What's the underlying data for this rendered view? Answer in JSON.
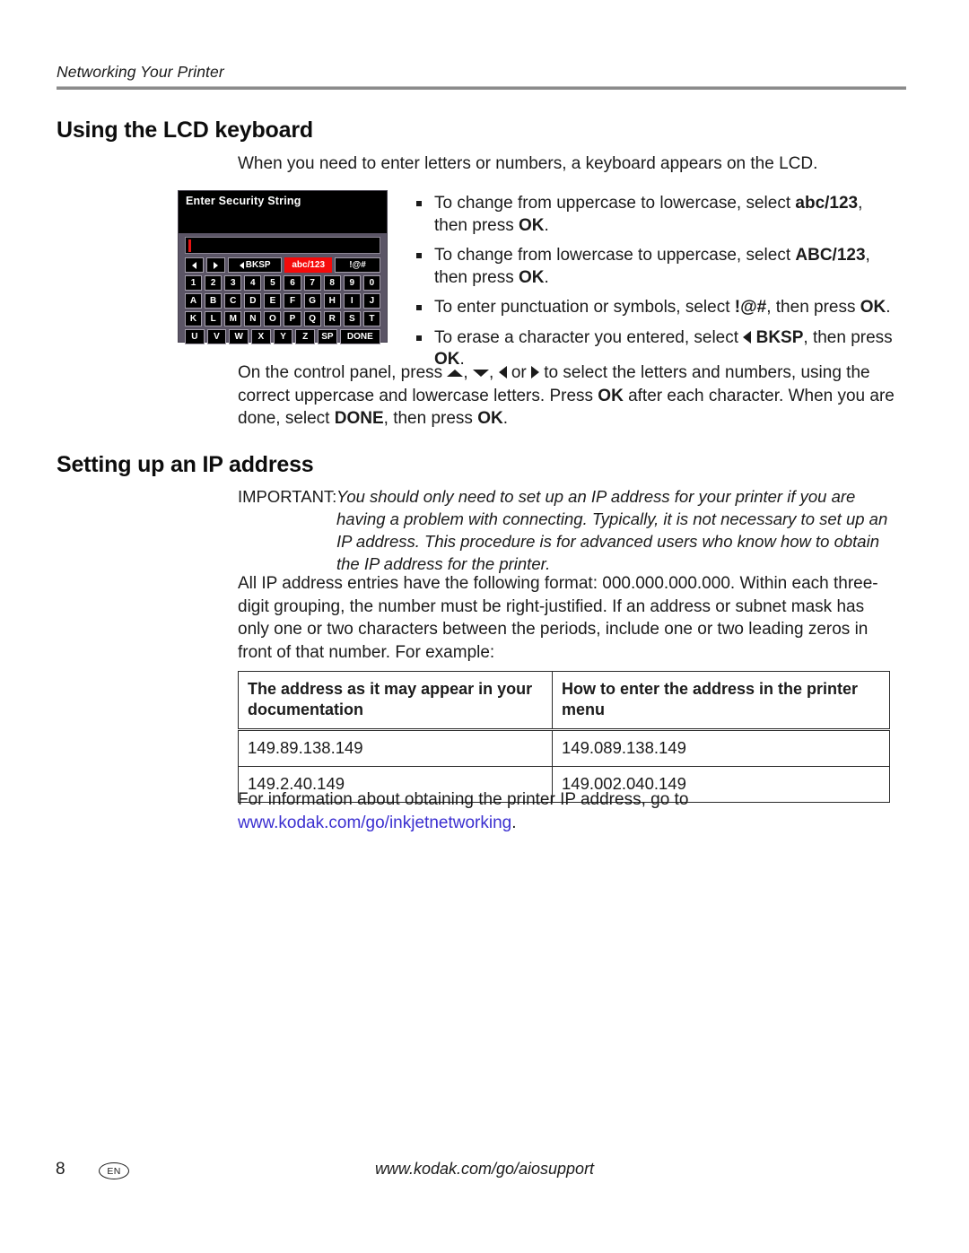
{
  "header": {
    "running_head": "Networking Your Printer"
  },
  "sections": [
    {
      "id": "lcd_keyboard",
      "title": "Using the LCD keyboard"
    },
    {
      "id": "ip_address",
      "title": "Setting up an IP address"
    }
  ],
  "intro": {
    "text": "When you need to enter letters or numbers, a keyboard appears on the LCD."
  },
  "bullets": [
    {
      "pre": "To change from uppercase to lowercase, select ",
      "bold1": "abc/123",
      "mid": ", then press ",
      "bold2": "OK",
      "post": "."
    },
    {
      "pre": "To change from lowercase to uppercase, select ",
      "bold1": "ABC/123",
      "mid": ", then press ",
      "bold2": "OK",
      "post": "."
    },
    {
      "pre": "To enter punctuation or symbols, select ",
      "bold1": "!@#",
      "mid": ", then press ",
      "bold2": "OK",
      "post": "."
    },
    {
      "pre": "To erase a character you entered, select ",
      "icon": "left-triangle-icon",
      "bold1": "BKSP",
      "mid": ", then press ",
      "bold2": "OK",
      "post": "."
    }
  ],
  "control_panel_paragraph": {
    "p1": "On the control panel, press ",
    "icon_up": "up-triangle-icon",
    "sep1": ", ",
    "icon_down": "down-triangle-icon",
    "sep2": ", ",
    "icon_left": "left-triangle-icon",
    "or": " or ",
    "icon_right": "right-triangle-icon",
    "p2": " to select the letters and numbers, using the correct uppercase and lowercase letters. Press ",
    "ok1": "OK",
    "p3": " after each character. When you are done, select ",
    "done": "DONE",
    "p4": ", then press ",
    "ok2": "OK",
    "p5": "."
  },
  "lcd": {
    "title": "Enter Security String",
    "field_value": "",
    "caret_color": "#e81313",
    "selected_key": "abc/123",
    "selected_key_color": "#f50b0b",
    "function_keys": [
      {
        "label": "",
        "icon": "left-arrow-icon",
        "type": "arrow-left"
      },
      {
        "label": "",
        "icon": "right-arrow-icon",
        "type": "arrow-right"
      },
      {
        "label": "BKSP",
        "icon": "left-arrow-icon",
        "type": "bksp"
      },
      {
        "label": "abc/123",
        "type": "abc",
        "selected": true
      },
      {
        "label": "!@#",
        "type": "sym"
      }
    ],
    "rows": [
      [
        "1",
        "2",
        "3",
        "4",
        "5",
        "6",
        "7",
        "8",
        "9",
        "0"
      ],
      [
        "A",
        "B",
        "C",
        "D",
        "E",
        "F",
        "G",
        "H",
        "I",
        "J"
      ],
      [
        "K",
        "L",
        "M",
        "N",
        "O",
        "P",
        "Q",
        "R",
        "S",
        "T"
      ],
      [
        "U",
        "V",
        "W",
        "X",
        "Y",
        "Z",
        "SP",
        "DONE"
      ]
    ]
  },
  "important_note": {
    "label": "IMPORTANT:",
    "text": "You should only need to set up an IP address for your printer if you are having a problem with connecting. Typically, it is not necessary to set up an IP address. This procedure is for advanced users who know how to obtain the IP address for the printer."
  },
  "ip_format_paragraph": {
    "text": "All IP address entries have the following format: 000.000.000.000. Within each three-digit grouping, the number must be right-justified. If an address or subnet mask has only one or two characters between the periods, include one or two leading zeros in front of that number. For example:"
  },
  "ip_table": {
    "headers": [
      "The address as it may appear in your documentation",
      "How to enter the address in the printer menu"
    ],
    "rows": [
      [
        "149.89.138.149",
        "149.089.138.149"
      ],
      [
        "149.2.40.149",
        "149.002.040.149"
      ]
    ]
  },
  "goto_paragraph": {
    "text": "For information about obtaining the printer IP address, go to ",
    "link": "www.kodak.com/go/inkjetnetworking",
    "period": ".",
    "link_color": "#3b2fd0"
  },
  "footer": {
    "page_number": "8",
    "language_badge": "EN",
    "url": "www.kodak.com/go/aiosupport"
  }
}
